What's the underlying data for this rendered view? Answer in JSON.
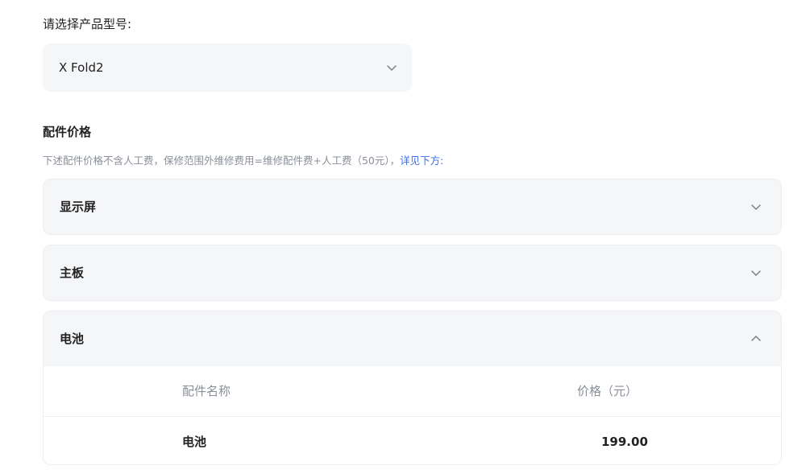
{
  "product_select": {
    "label": "请选择产品型号:",
    "selected_value": "X Fold2",
    "icon": "chevron-down-icon"
  },
  "parts_section": {
    "title": "配件价格",
    "description": "下述配件价格不含人工费，保修范围外维修费用=维修配件费+人工费（50元），",
    "link_text": "详见下方:"
  },
  "accordions": [
    {
      "title": "显示屏",
      "expanded": false
    },
    {
      "title": "主板",
      "expanded": false
    },
    {
      "title": "电池",
      "expanded": true,
      "table": {
        "headers": [
          "配件名称",
          "价格（元）"
        ],
        "rows": [
          {
            "name": "电池",
            "price": "199.00"
          }
        ]
      }
    }
  ]
}
